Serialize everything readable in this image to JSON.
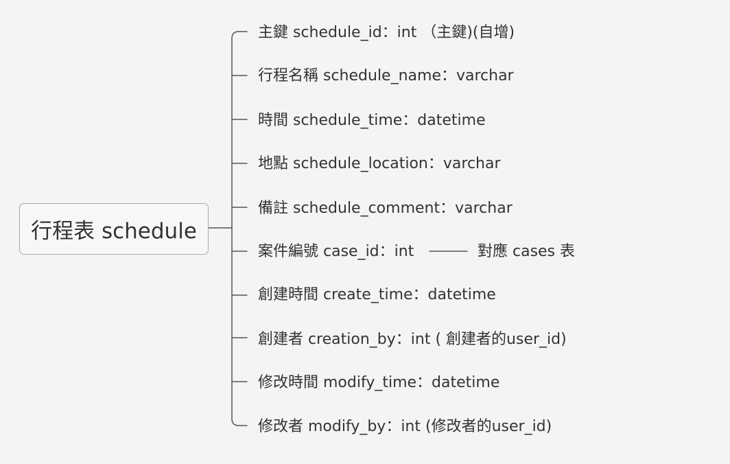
{
  "root": {
    "label": "行程表 schedule"
  },
  "fields": [
    {
      "label": "主鍵 schedule_id：int （主鍵)(自增)"
    },
    {
      "label": "行程名稱  schedule_name：varchar"
    },
    {
      "label": "時間  schedule_time：datetime"
    },
    {
      "label": "地點  schedule_location：varchar"
    },
    {
      "label": "備註 schedule_comment：varchar"
    },
    {
      "label": "案件編號 case_id：int"
    },
    {
      "label": "創建時間 create_time：datetime"
    },
    {
      "label": "創建者 creation_by：int ( 創建者的user_id)"
    },
    {
      "label": "修改時間 modify_time：datetime"
    },
    {
      "label": "修改者 modify_by：int (修改者的user_id)"
    }
  ],
  "reference": {
    "label": "對應 cases 表"
  }
}
